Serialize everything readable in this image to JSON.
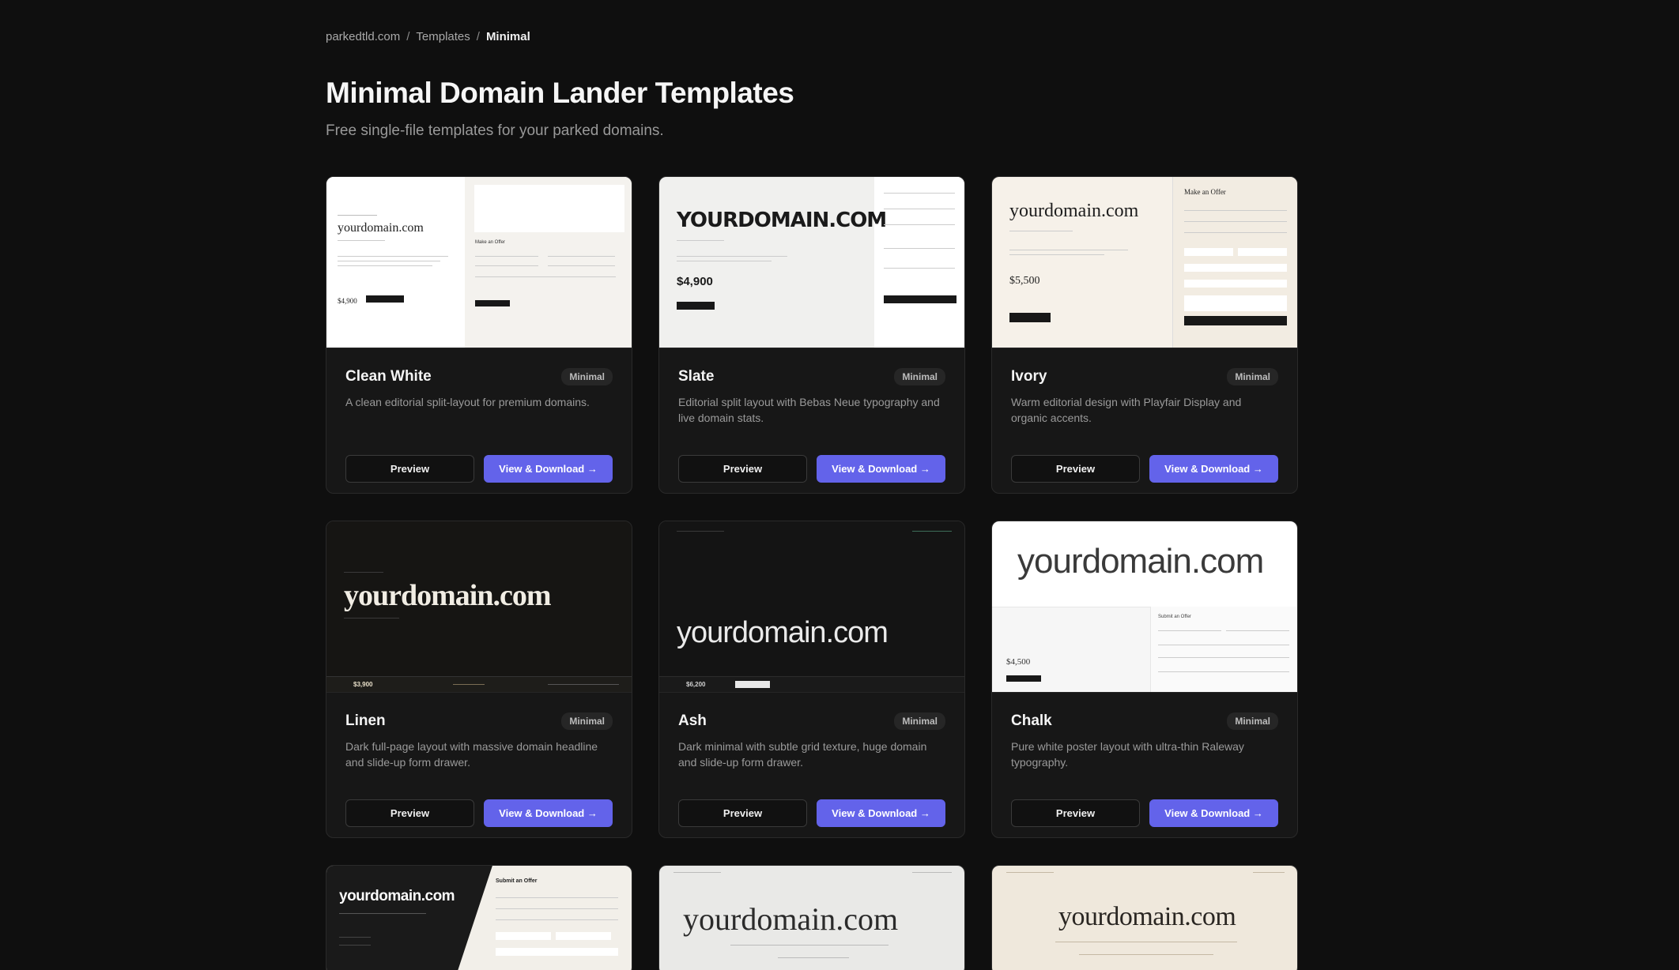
{
  "breadcrumb": {
    "root": "parkedtld.com",
    "section": "Templates",
    "current": "Minimal",
    "separator": "/"
  },
  "header": {
    "title": "Minimal Domain Lander Templates",
    "subtitle": "Free single-file templates for your parked domains."
  },
  "common": {
    "preview_label": "Preview",
    "download_label": "View & Download →",
    "badge": "Minimal"
  },
  "templates": [
    {
      "name": "Clean White",
      "description": "A clean editorial split-layout for premium domains.",
      "preview_domain": "yourdomain.com",
      "preview_price": "$4,900"
    },
    {
      "name": "Slate",
      "description": "Editorial split layout with Bebas Neue typography and live domain stats.",
      "preview_domain": "YOURDOMAIN.COM",
      "preview_price": "$4,900"
    },
    {
      "name": "Ivory",
      "description": "Warm editorial design with Playfair Display and organic accents.",
      "preview_domain": "yourdomain.com",
      "preview_price": "$5,500"
    },
    {
      "name": "Linen",
      "description": "Dark full-page layout with massive domain headline and slide-up form drawer.",
      "preview_domain": "yourdomain.com",
      "preview_price": "$3,900"
    },
    {
      "name": "Ash",
      "description": "Dark minimal with subtle grid texture, huge domain and slide-up form drawer.",
      "preview_domain": "yourdomain.com",
      "preview_price": "$6,200"
    },
    {
      "name": "Chalk",
      "description": "Pure white poster layout with ultra-thin Raleway typography.",
      "preview_domain": "yourdomain.com",
      "preview_price": "$4,500"
    },
    {
      "name": "",
      "description": "",
      "preview_domain": "yourdomain.com",
      "preview_price": ""
    },
    {
      "name": "",
      "description": "",
      "preview_domain": "yourdomain.com",
      "preview_price": ""
    },
    {
      "name": "",
      "description": "",
      "preview_domain": "yourdomain.com",
      "preview_price": ""
    }
  ],
  "thumb_text": {
    "make_offer": "Make an Offer",
    "submit_offer": "Submit an Offer"
  }
}
